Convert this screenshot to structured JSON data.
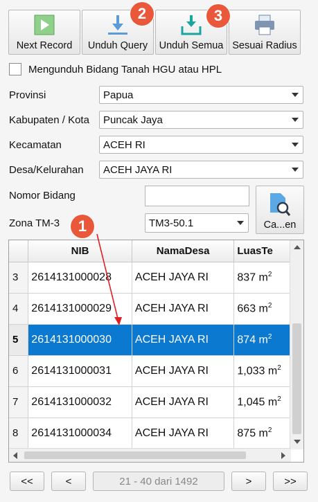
{
  "toolbar": {
    "next_record": "Next Record",
    "unduh_query": "Unduh Query",
    "unduh_semua": "Unduh Semua",
    "sesuai_radius": "Sesuai Radius"
  },
  "badges": {
    "b1": "1",
    "b2": "2",
    "b3": "3"
  },
  "checkbox_label": "Mengunduh Bidang Tanah HGU atau HPL",
  "form": {
    "provinsi_label": "Provinsi",
    "provinsi_value": "Papua",
    "kabupaten_label": "Kabupaten / Kota",
    "kabupaten_value": "Puncak Jaya",
    "kecamatan_label": "Kecamatan",
    "kecamatan_value": "ACEH RI",
    "desa_label": "Desa/Kelurahan",
    "desa_value": "ACEH JAYA RI",
    "nomor_label": "Nomor Bidang",
    "nomor_value": "",
    "zona_label": "Zona TM-3",
    "zona_value": "TM3-50.1",
    "cari_label": "Ca...en"
  },
  "table": {
    "headers": [
      "NIB",
      "NamaDesa",
      "LuasTe"
    ],
    "rows": [
      {
        "num": "3",
        "nib": "2614131000028",
        "desa": "ACEH JAYA RI",
        "luas": "837 m",
        "sup": "2"
      },
      {
        "num": "4",
        "nib": "2614131000029",
        "desa": "ACEH JAYA RI",
        "luas": "663 m",
        "sup": "2"
      },
      {
        "num": "5",
        "nib": "2614131000030",
        "desa": "ACEH JAYA RI",
        "luas": "874 m",
        "sup": "2"
      },
      {
        "num": "6",
        "nib": "2614131000031",
        "desa": "ACEH JAYA RI",
        "luas": "1,033 m",
        "sup": "2"
      },
      {
        "num": "7",
        "nib": "2614131000032",
        "desa": "ACEH JAYA RI",
        "luas": "1,045 m",
        "sup": "2"
      },
      {
        "num": "8",
        "nib": "2614131000034",
        "desa": "ACEH JAYA RI",
        "luas": "875 m",
        "sup": "2"
      }
    ],
    "selected_row": 2
  },
  "pager": {
    "first": "<<",
    "prev": "<",
    "label": "21 - 40 dari 1492",
    "next": ">",
    "last": ">>"
  },
  "colors": {
    "badge": "#e9583a",
    "selection": "#0b79d0",
    "arrow": "#e02020"
  },
  "icons": [
    "next-record-icon",
    "download-icon",
    "download-all-icon",
    "printer-icon",
    "search-document-icon"
  ]
}
